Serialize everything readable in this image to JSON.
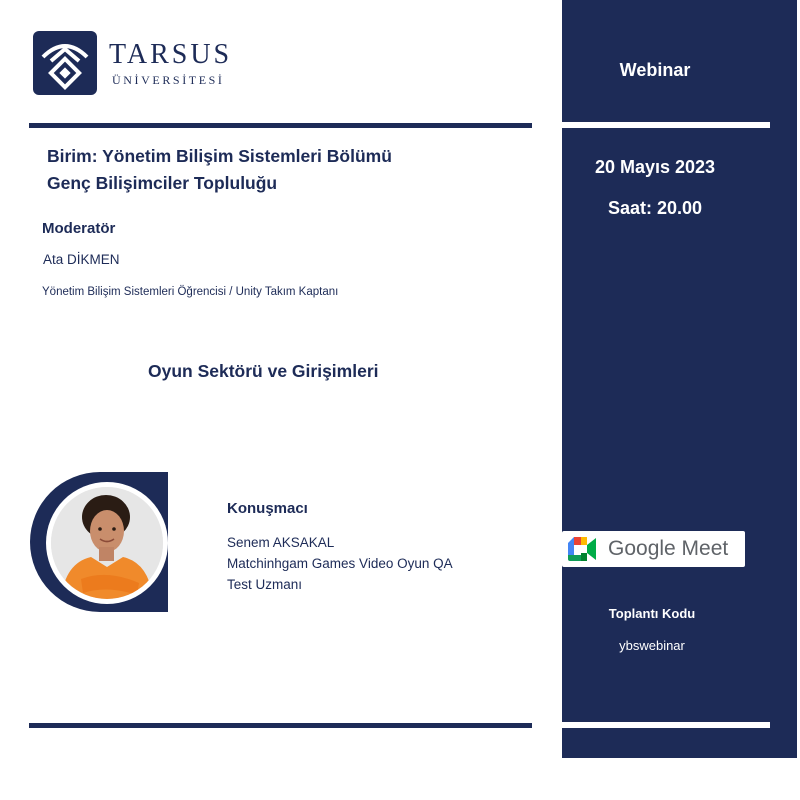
{
  "logo": {
    "name": "TARSUS",
    "subtitle": "ÜNİVERSİTESİ"
  },
  "event": {
    "type": "Webinar",
    "date": "20 Mayıs 2023",
    "time": "Saat: 20.00"
  },
  "unit": {
    "line1": "Birim: Yönetim Bilişim Sistemleri Bölümü",
    "line2": "Genç Bilişimciler Topluluğu"
  },
  "moderator": {
    "heading": "Moderatör",
    "name": "Ata DİKMEN",
    "role": "Yönetim Bilişim Sistemleri Öğrencisi / Unity Takım Kaptanı"
  },
  "topic": "Oyun Sektörü ve Girişimleri",
  "speaker": {
    "heading": "Konuşmacı",
    "name": "Senem AKSAKAL",
    "title_line1": "Matchinhgam Games Video Oyun QA",
    "title_line2": "Test Uzmanı"
  },
  "meeting": {
    "platform": "Google Meet",
    "code_label": "Toplantı Kodu",
    "code": "ybswebinar"
  },
  "colors": {
    "navy": "#1d2b57",
    "white": "#ffffff"
  },
  "icons": [
    "university-emblem-icon",
    "google-meet-icon"
  ]
}
